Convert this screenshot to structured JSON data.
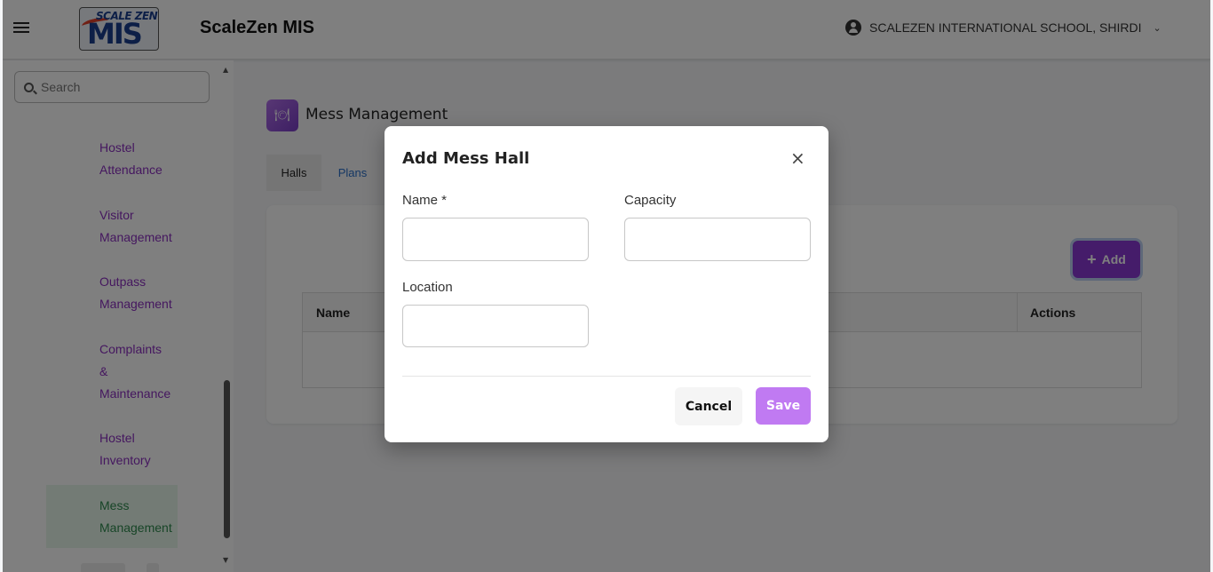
{
  "header": {
    "app_title": "ScaleZen MIS",
    "logo_top": "SCALE ZEN",
    "logo_main": "MIS",
    "school_name": "SCALEZEN INTERNATIONAL SCHOOL, SHIRDI"
  },
  "sidebar": {
    "search_placeholder": "Search",
    "items": [
      {
        "line1": "Hostel",
        "line2": "Attendance"
      },
      {
        "line1": "Visitor",
        "line2": "Management"
      },
      {
        "line1": "Outpass",
        "line2": "Management"
      },
      {
        "line1": "Complaints",
        "line2": "&",
        "line3": "Maintenance"
      },
      {
        "line1": "Hostel",
        "line2": "Inventory"
      },
      {
        "line1": "Mess",
        "line2": "Management",
        "active": true
      }
    ]
  },
  "main": {
    "page_title": "Mess Management",
    "tabs": [
      {
        "label": "Halls",
        "active": true
      },
      {
        "label": "Plans"
      }
    ],
    "add_button": "Add",
    "table": {
      "columns": [
        "Name",
        "Actions"
      ]
    }
  },
  "modal": {
    "title": "Add Mess Hall",
    "fields": {
      "name_label": "Name *",
      "capacity_label": "Capacity",
      "location_label": "Location",
      "name_value": "",
      "capacity_value": "",
      "location_value": ""
    },
    "cancel_label": "Cancel",
    "save_label": "Save"
  },
  "colors": {
    "brand_purple": "#8a39d4",
    "save_purple": "#c07af2",
    "nav_purple": "#8a2fbf",
    "nav_active_green": "#2e8a4e"
  }
}
